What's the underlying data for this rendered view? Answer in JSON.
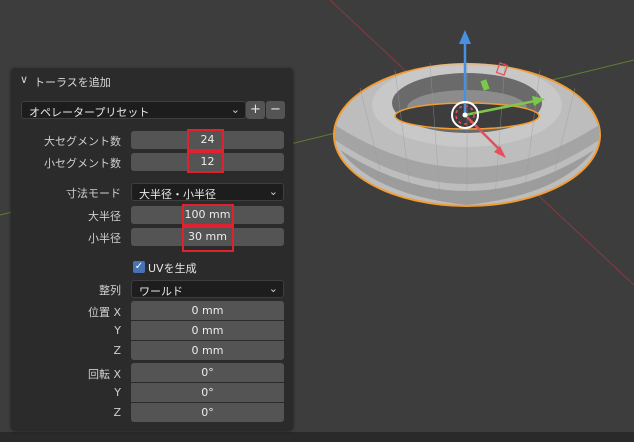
{
  "panel": {
    "title": "トーラスを追加",
    "preset": {
      "label": "オペレータープリセット",
      "add": "+",
      "remove": "−"
    },
    "major_segments": {
      "label": "大セグメント数",
      "value": "24"
    },
    "minor_segments": {
      "label": "小セグメント数",
      "value": "12"
    },
    "dimension_mode": {
      "label": "寸法モード",
      "value": "大半径・小半径"
    },
    "major_radius": {
      "label": "大半径",
      "value": "100 mm"
    },
    "minor_radius": {
      "label": "小半径",
      "value": "30 mm"
    },
    "generate_uv": {
      "label": "UVを生成",
      "checked": true
    },
    "align": {
      "label": "整列",
      "value": "ワールド"
    },
    "location": {
      "label": "位置 X",
      "y_label": "Y",
      "z_label": "Z",
      "x": "0 mm",
      "y": "0 mm",
      "z": "0 mm"
    },
    "rotation": {
      "label": "回転 X",
      "y_label": "Y",
      "z_label": "Z",
      "x": "0°",
      "y": "0°",
      "z": "0°"
    }
  },
  "icons": {
    "collapse": "chevron-down-icon",
    "dropdown": "chevron-down-icon",
    "check": "check-icon"
  },
  "colors": {
    "highlight": "#e0212e",
    "selection_outline": "#f29c33",
    "gizmo_z": "#4a90e2",
    "gizmo_x": "#e84e5a",
    "gizmo_y": "#7cc94a",
    "checkbox": "#4772b3"
  }
}
